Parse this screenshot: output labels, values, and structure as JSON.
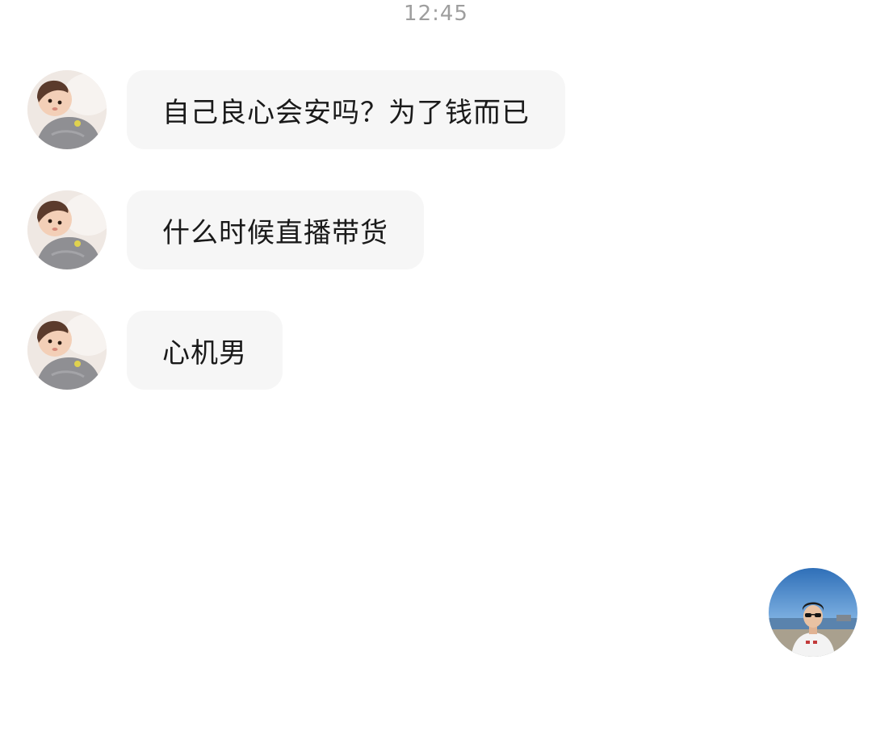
{
  "chat": {
    "timestamp": "12:45",
    "messages": [
      {
        "sender": "other",
        "text": "自己良心会安吗？为了钱而已"
      },
      {
        "sender": "other",
        "text": "什么时候直播带货"
      },
      {
        "sender": "other",
        "text": "心机男"
      }
    ],
    "other_avatar_icon": "baby-photo-avatar",
    "self_avatar_icon": "beach-photo-avatar"
  },
  "colors": {
    "background": "#ffffff",
    "bubble": "#f6f6f6",
    "timestamp": "#9e9e9e",
    "text": "#1a1a1a"
  }
}
